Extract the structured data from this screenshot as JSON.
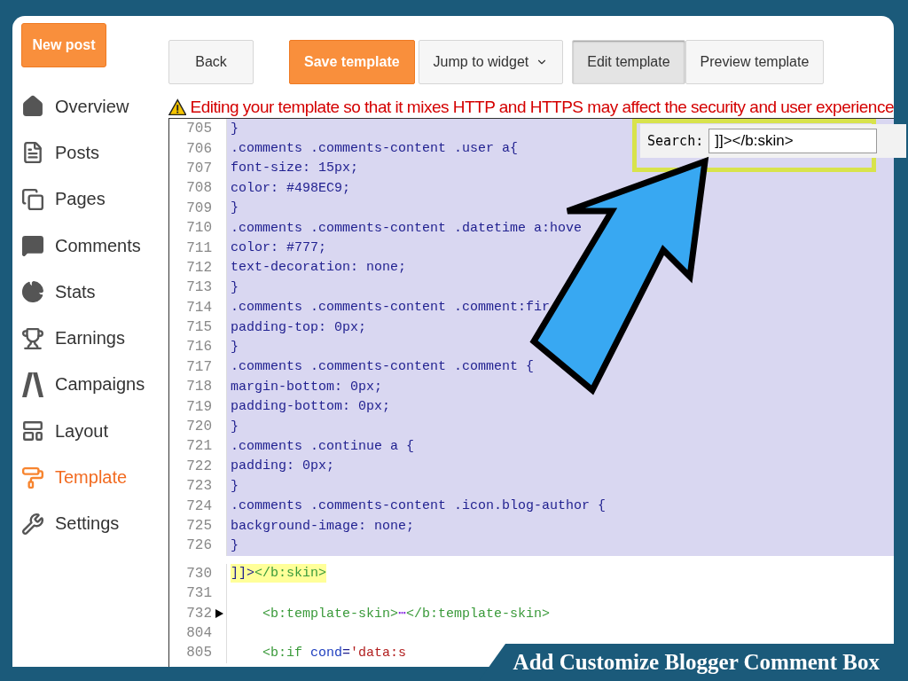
{
  "sidebar": {
    "new_post": "New post",
    "items": [
      {
        "label": "Overview",
        "kind": "home",
        "selected": false
      },
      {
        "label": "Posts",
        "kind": "posts",
        "selected": false
      },
      {
        "label": "Pages",
        "kind": "pages",
        "selected": false
      },
      {
        "label": "Comments",
        "kind": "comments",
        "selected": false
      },
      {
        "label": "Stats",
        "kind": "stats",
        "selected": false
      },
      {
        "label": "Earnings",
        "kind": "earnings",
        "selected": false
      },
      {
        "label": "Campaigns",
        "kind": "campaigns",
        "selected": false
      },
      {
        "label": "Layout",
        "kind": "layout",
        "selected": false
      },
      {
        "label": "Template",
        "kind": "template",
        "selected": true
      },
      {
        "label": "Settings",
        "kind": "settings",
        "selected": false
      }
    ]
  },
  "toolbar": {
    "back": "Back",
    "save": "Save template",
    "jump": "Jump to widget",
    "modes": [
      {
        "label": "Edit template",
        "selected": true
      },
      {
        "label": "Preview template",
        "selected": false
      }
    ]
  },
  "warning": "Editing your template so that it mixes HTTP and HTTPS may affect the security and user experience",
  "search": {
    "label": "Search:",
    "value": "]]></b:skin>"
  },
  "editor": {
    "lines": [
      {
        "number": "705",
        "selected": true,
        "segments": [
          {
            "kind": "css",
            "text": "}"
          }
        ]
      },
      {
        "number": "706",
        "selected": true,
        "segments": [
          {
            "kind": "css",
            "text": ".comments .comments-content .user a{"
          }
        ]
      },
      {
        "number": "707",
        "selected": true,
        "segments": [
          {
            "kind": "css",
            "text": "font-size: 15px;"
          }
        ]
      },
      {
        "number": "708",
        "selected": true,
        "segments": [
          {
            "kind": "css",
            "text": "color: #498EC9;"
          }
        ]
      },
      {
        "number": "709",
        "selected": true,
        "segments": [
          {
            "kind": "css",
            "text": "}"
          }
        ]
      },
      {
        "number": "710",
        "selected": true,
        "segments": [
          {
            "kind": "css",
            "text": ".comments .comments-content .datetime a:hove"
          }
        ]
      },
      {
        "number": "711",
        "selected": true,
        "segments": [
          {
            "kind": "css",
            "text": "color: #777;"
          }
        ]
      },
      {
        "number": "712",
        "selected": true,
        "segments": [
          {
            "kind": "css",
            "text": "text-decoration: none;"
          }
        ]
      },
      {
        "number": "713",
        "selected": true,
        "segments": [
          {
            "kind": "css",
            "text": "}"
          }
        ]
      },
      {
        "number": "714",
        "selected": true,
        "segments": [
          {
            "kind": "css",
            "text": ".comments .comments-content .comment:fir"
          }
        ]
      },
      {
        "number": "715",
        "selected": true,
        "segments": [
          {
            "kind": "css",
            "text": "padding-top: 0px;"
          }
        ]
      },
      {
        "number": "716",
        "selected": true,
        "segments": [
          {
            "kind": "css",
            "text": "}"
          }
        ]
      },
      {
        "number": "717",
        "selected": true,
        "segments": [
          {
            "kind": "css",
            "text": ".comments .comments-content .comment {"
          }
        ]
      },
      {
        "number": "718",
        "selected": true,
        "segments": [
          {
            "kind": "css",
            "text": "margin-bottom: 0px;"
          }
        ]
      },
      {
        "number": "719",
        "selected": true,
        "segments": [
          {
            "kind": "css",
            "text": "padding-bottom: 0px;"
          }
        ]
      },
      {
        "number": "720",
        "selected": true,
        "segments": [
          {
            "kind": "css",
            "text": "}"
          }
        ]
      },
      {
        "number": "721",
        "selected": true,
        "segments": [
          {
            "kind": "css",
            "text": ".comments .continue a {"
          }
        ]
      },
      {
        "number": "722",
        "selected": true,
        "segments": [
          {
            "kind": "css",
            "text": "padding: 0px;"
          }
        ]
      },
      {
        "number": "723",
        "selected": true,
        "segments": [
          {
            "kind": "css",
            "text": "}"
          }
        ]
      },
      {
        "number": "724",
        "selected": true,
        "segments": [
          {
            "kind": "css",
            "text": ".comments .comments-content .icon.blog-author {"
          }
        ]
      },
      {
        "number": "725",
        "selected": true,
        "segments": [
          {
            "kind": "css",
            "text": "background-image: none;"
          }
        ]
      },
      {
        "number": "726",
        "selected": true,
        "segments": [
          {
            "kind": "css",
            "text": "}"
          }
        ]
      },
      {
        "number": "730",
        "selected": false,
        "highlighted": true,
        "segments": [
          {
            "kind": "css",
            "text": "]]>"
          },
          {
            "kind": "tag",
            "text": "</b:skin>"
          }
        ]
      },
      {
        "number": "731",
        "selected": false
      },
      {
        "number": "732",
        "selected": false,
        "folded": true,
        "indent": true,
        "segments": [
          {
            "kind": "tag",
            "text": "<b:template-skin>"
          },
          {
            "kind": "ellipsis",
            "text": "⋯"
          },
          {
            "kind": "tag",
            "text": "</b:template-skin>"
          }
        ]
      },
      {
        "number": "804",
        "selected": false
      },
      {
        "number": "805",
        "selected": false,
        "indent": true,
        "segments": [
          {
            "kind": "tag",
            "text": "<b:if"
          },
          {
            "kind": "attr",
            "text": " cond"
          },
          {
            "kind": "css",
            "text": "="
          },
          {
            "kind": "string",
            "text": "'data:s"
          }
        ]
      }
    ]
  },
  "caption": "Add Customize Blogger Comment Box"
}
